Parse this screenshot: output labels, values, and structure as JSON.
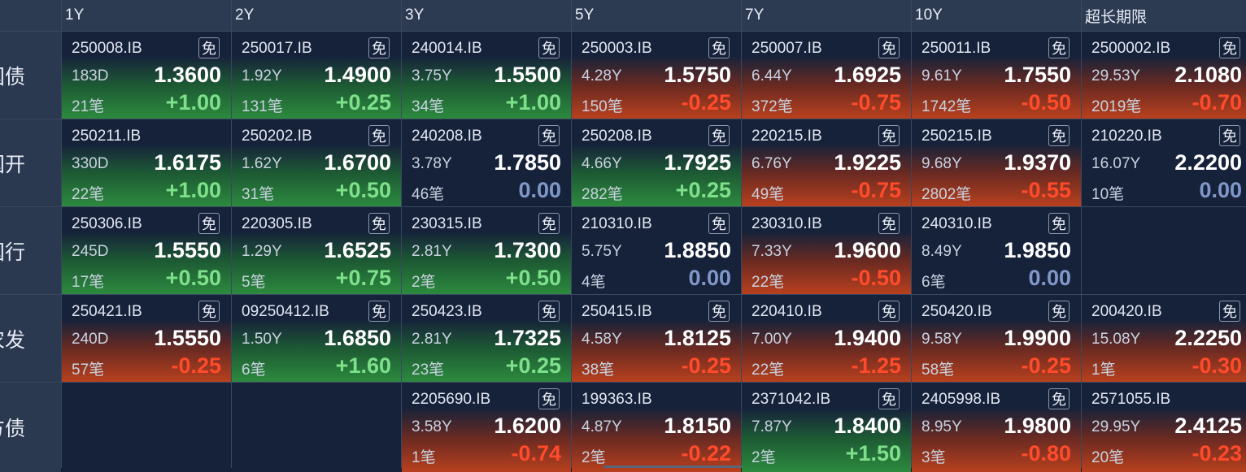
{
  "columns": [
    "1Y",
    "2Y",
    "3Y",
    "5Y",
    "7Y",
    "10Y",
    "超长期限"
  ],
  "rows": [
    {
      "label": "国债",
      "cells": [
        {
          "code": "250008.IB",
          "mian": "免",
          "term": "183D",
          "price": "1.3600",
          "count": "21笔",
          "change": "+1.00",
          "trend": "up"
        },
        {
          "code": "250017.IB",
          "mian": "免",
          "term": "1.92Y",
          "price": "1.4900",
          "count": "131笔",
          "change": "+0.25",
          "trend": "up"
        },
        {
          "code": "240014.IB",
          "mian": "免",
          "term": "3.75Y",
          "price": "1.5500",
          "count": "34笔",
          "change": "+1.00",
          "trend": "up"
        },
        {
          "code": "250003.IB",
          "mian": "免",
          "term": "4.28Y",
          "price": "1.5750",
          "count": "150笔",
          "change": "-0.25",
          "trend": "down"
        },
        {
          "code": "250007.IB",
          "mian": "免",
          "term": "6.44Y",
          "price": "1.6925",
          "count": "372笔",
          "change": "-0.75",
          "trend": "down"
        },
        {
          "code": "250011.IB",
          "mian": "免",
          "term": "9.61Y",
          "price": "1.7550",
          "count": "1742笔",
          "change": "-0.50",
          "trend": "down"
        },
        {
          "code": "2500002.IB",
          "mian": "免",
          "term": "29.53Y",
          "price": "2.1080",
          "count": "2019笔",
          "change": "-0.70",
          "trend": "down"
        }
      ]
    },
    {
      "label": "国开",
      "cells": [
        {
          "code": "250211.IB",
          "mian": "",
          "term": "330D",
          "price": "1.6175",
          "count": "22笔",
          "change": "+1.00",
          "trend": "up"
        },
        {
          "code": "250202.IB",
          "mian": "免",
          "term": "1.62Y",
          "price": "1.6700",
          "count": "31笔",
          "change": "+0.50",
          "trend": "up"
        },
        {
          "code": "240208.IB",
          "mian": "免",
          "term": "3.78Y",
          "price": "1.7850",
          "count": "46笔",
          "change": "0.00",
          "trend": "flat"
        },
        {
          "code": "250208.IB",
          "mian": "免",
          "term": "4.66Y",
          "price": "1.7925",
          "count": "282笔",
          "change": "+0.25",
          "trend": "up"
        },
        {
          "code": "220215.IB",
          "mian": "免",
          "term": "6.76Y",
          "price": "1.9225",
          "count": "49笔",
          "change": "-0.75",
          "trend": "down"
        },
        {
          "code": "250215.IB",
          "mian": "免",
          "term": "9.68Y",
          "price": "1.9370",
          "count": "2802笔",
          "change": "-0.55",
          "trend": "down"
        },
        {
          "code": "210220.IB",
          "mian": "免",
          "term": "16.07Y",
          "price": "2.2200",
          "count": "10笔",
          "change": "0.00",
          "trend": "flat"
        }
      ]
    },
    {
      "label": "国行",
      "cells": [
        {
          "code": "250306.IB",
          "mian": "免",
          "term": "245D",
          "price": "1.5550",
          "count": "17笔",
          "change": "+0.50",
          "trend": "up"
        },
        {
          "code": "220305.IB",
          "mian": "免",
          "term": "1.29Y",
          "price": "1.6525",
          "count": "5笔",
          "change": "+0.75",
          "trend": "up"
        },
        {
          "code": "230315.IB",
          "mian": "免",
          "term": "2.81Y",
          "price": "1.7300",
          "count": "2笔",
          "change": "+0.50",
          "trend": "up"
        },
        {
          "code": "210310.IB",
          "mian": "免",
          "term": "5.75Y",
          "price": "1.8850",
          "count": "4笔",
          "change": "0.00",
          "trend": "flat"
        },
        {
          "code": "230310.IB",
          "mian": "免",
          "term": "7.33Y",
          "price": "1.9600",
          "count": "22笔",
          "change": "-0.50",
          "trend": "down"
        },
        {
          "code": "240310.IB",
          "mian": "免",
          "term": "8.49Y",
          "price": "1.9850",
          "count": "6笔",
          "change": "0.00",
          "trend": "flat"
        },
        null
      ]
    },
    {
      "label": "农发",
      "cells": [
        {
          "code": "250421.IB",
          "mian": "免",
          "term": "240D",
          "price": "1.5550",
          "count": "57笔",
          "change": "-0.25",
          "trend": "down"
        },
        {
          "code": "09250412.IB",
          "mian": "免",
          "term": "1.50Y",
          "price": "1.6850",
          "count": "6笔",
          "change": "+1.60",
          "trend": "up"
        },
        {
          "code": "250423.IB",
          "mian": "免",
          "term": "2.81Y",
          "price": "1.7325",
          "count": "23笔",
          "change": "+0.25",
          "trend": "up"
        },
        {
          "code": "250415.IB",
          "mian": "免",
          "term": "4.58Y",
          "price": "1.8125",
          "count": "38笔",
          "change": "-0.25",
          "trend": "down"
        },
        {
          "code": "220410.IB",
          "mian": "免",
          "term": "7.00Y",
          "price": "1.9400",
          "count": "22笔",
          "change": "-1.25",
          "trend": "down"
        },
        {
          "code": "250420.IB",
          "mian": "免",
          "term": "9.58Y",
          "price": "1.9900",
          "count": "58笔",
          "change": "-0.25",
          "trend": "down"
        },
        {
          "code": "200420.IB",
          "mian": "免",
          "term": "15.08Y",
          "price": "2.2250",
          "count": "1笔",
          "change": "-0.30",
          "trend": "down"
        }
      ]
    },
    {
      "label": "地方债",
      "cells": [
        null,
        null,
        {
          "code": "2205690.IB",
          "mian": "免",
          "term": "3.58Y",
          "price": "1.6200",
          "count": "1笔",
          "change": "-0.74",
          "trend": "down"
        },
        {
          "code": "199363.IB",
          "mian": "",
          "term": "4.87Y",
          "price": "1.8150",
          "count": "2笔",
          "change": "-0.22",
          "trend": "down"
        },
        {
          "code": "2371042.IB",
          "mian": "免",
          "term": "7.87Y",
          "price": "1.8400",
          "count": "2笔",
          "change": "+1.50",
          "trend": "up"
        },
        {
          "code": "2405998.IB",
          "mian": "免",
          "term": "8.95Y",
          "price": "1.9800",
          "count": "3笔",
          "change": "-0.80",
          "trend": "down"
        },
        {
          "code": "2571055.IB",
          "mian": "",
          "term": "29.95Y",
          "price": "2.4125",
          "count": "20笔",
          "change": "-0.23",
          "trend": "down"
        }
      ]
    }
  ]
}
